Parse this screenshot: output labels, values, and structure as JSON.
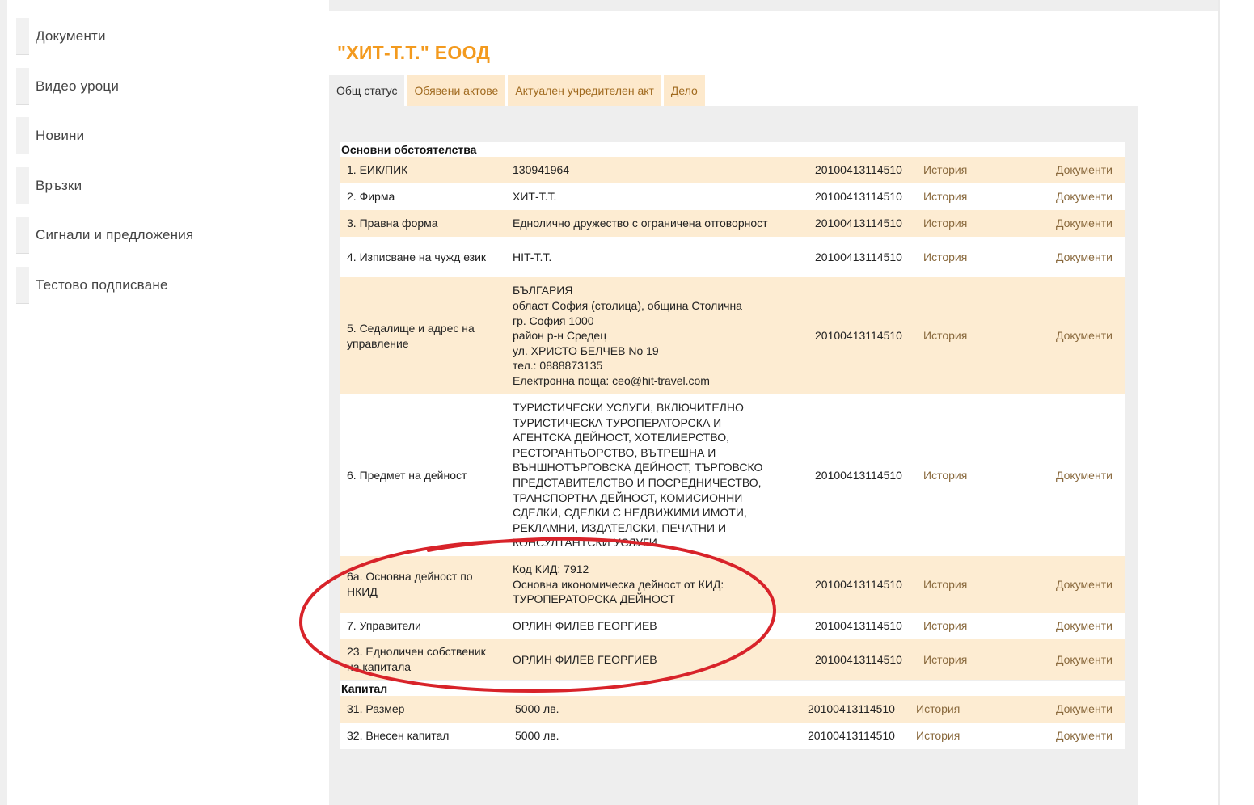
{
  "sidebar": {
    "items": [
      {
        "label": "Документи"
      },
      {
        "label": "Видео уроци"
      },
      {
        "label": "Новини"
      },
      {
        "label": "Връзки"
      },
      {
        "label": "Сигнали и предложения"
      },
      {
        "label": "Тестово подписване"
      }
    ]
  },
  "company": {
    "title": "\"ХИТ-Т.Т.\" ЕООД"
  },
  "tabs": [
    {
      "label": "Общ статус"
    },
    {
      "label": "Обявени актове"
    },
    {
      "label": "Актуален учредителен акт"
    },
    {
      "label": "Дело"
    }
  ],
  "sections": {
    "main": "Основни обстоятелства",
    "capital": "Капитал"
  },
  "rows": [
    {
      "label": "1.  ЕИК/ПИК",
      "value": "130941964",
      "date": "20100413114510",
      "history": "История",
      "docs": "Документи"
    },
    {
      "label": "2.  Фирма",
      "value": "ХИТ-Т.Т.",
      "date": "20100413114510",
      "history": "История",
      "docs": "Документи"
    },
    {
      "label": "3.  Правна форма",
      "value": "Еднолично дружество с ограничена отговорност",
      "date": "20100413114510",
      "history": "История",
      "docs": "Документи"
    },
    {
      "label": "4.  Изписване на чужд език",
      "value": "HIT-T.T.",
      "date": "20100413114510",
      "history": "История",
      "docs": "Документи"
    },
    {
      "label": "5.  Седалище и адрес на управление",
      "address": {
        "country": "БЪЛГАРИЯ",
        "region": "област София (столица), община Столична",
        "city": "гр. София 1000",
        "district": "район р-н Средец",
        "street": "ул. ХРИСТО БЕЛЧЕВ No 19",
        "phone": "тел.: 0888873135",
        "email_label": "Електронна поща: ",
        "email": "ceo@hit-travel.com"
      },
      "date": "20100413114510",
      "history": "История",
      "docs": "Документи"
    },
    {
      "label": "6.  Предмет на дейност",
      "activity_lines": [
        "ТУРИСТИЧЕСКИ УСЛУГИ, ВКЛЮЧИТЕЛНО",
        "ТУРИСТИЧЕСКА ТУРОПЕРАТОРСКА И",
        "АГЕНТСКА ДЕЙНОСТ, ХОТЕЛИЕРСТВО,",
        "РЕСТОРАНТЬОРСТВО, ВЪТРЕШНА И",
        "ВЪНШНОТЪРГОВСКА ДЕЙНОСТ, ТЪРГОВСКО",
        "ПРЕДСТАВИТЕЛСТВО И ПОСРЕДНИЧЕСТВО,",
        "ТРАНСПОРТНА ДЕЙНОСТ, КОМИСИОННИ",
        "СДЕЛКИ, СДЕЛКИ С НЕДВИЖИМИ ИМОТИ,",
        "РЕКЛАМНИ, ИЗДАТЕЛСКИ, ПЕЧАТНИ И",
        "КОНСУЛТАНТСКИ УСЛУГИ."
      ],
      "date": "20100413114510",
      "history": "История",
      "docs": "Документи"
    },
    {
      "label": "6а.  Основна дейност по НКИД",
      "nkid_lines": [
        "Код КИД: 7912",
        "Основна икономическа дейност от КИД:",
        "ТУРОПЕРАТОРСКА ДЕЙНОСТ"
      ],
      "date": "20100413114510",
      "history": "История",
      "docs": "Документи"
    },
    {
      "label": "7.  Управители",
      "value": "ОРЛИН ФИЛЕВ ГЕОРГИЕВ",
      "date": "20100413114510",
      "history": "История",
      "docs": "Документи"
    },
    {
      "label": "23.  Едноличен собственик на капитала",
      "value": "ОРЛИН ФИЛЕВ ГЕОРГИЕВ",
      "date": "20100413114510",
      "history": "История",
      "docs": "Документи"
    }
  ],
  "capital_rows": [
    {
      "label": "31.  Размер",
      "value": "5000 лв.",
      "date": "20100413114510",
      "history": "История",
      "docs": "Документи"
    },
    {
      "label": "32.  Внесен капитал",
      "value": "5000 лв.",
      "date": "20100413114510",
      "history": "История",
      "docs": "Документи"
    }
  ],
  "colors": {
    "accent": "#f39a1e",
    "row_beige": "#fdecd2",
    "annotation": "#d8232a"
  }
}
